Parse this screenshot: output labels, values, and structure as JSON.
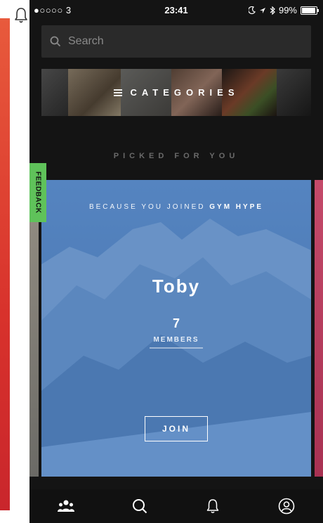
{
  "status_bar": {
    "carrier": "●○○○○ 3",
    "time": "23:41",
    "battery_percent": "99%",
    "battery_level": 0.99
  },
  "search": {
    "placeholder": "Search"
  },
  "categories": {
    "label": "CATEGORIES"
  },
  "section": {
    "picked_label": "PICKED FOR YOU"
  },
  "feedback": {
    "label": "FEEDBACK"
  },
  "card": {
    "reason_prefix": "BECAUSE YOU JOINED ",
    "reason_group": "GYM HYPE",
    "group_name": "Toby",
    "member_count": "7",
    "members_label": "MEMBERS",
    "join_label": "JOIN",
    "accent_color": "#4a79b4"
  },
  "tab_bar": {
    "items": [
      {
        "icon": "groups-icon"
      },
      {
        "icon": "search-icon"
      },
      {
        "icon": "bell-icon"
      },
      {
        "icon": "profile-icon"
      }
    ]
  },
  "colors": {
    "feedback_green": "#5fc25a",
    "background_dark": "#141414"
  }
}
